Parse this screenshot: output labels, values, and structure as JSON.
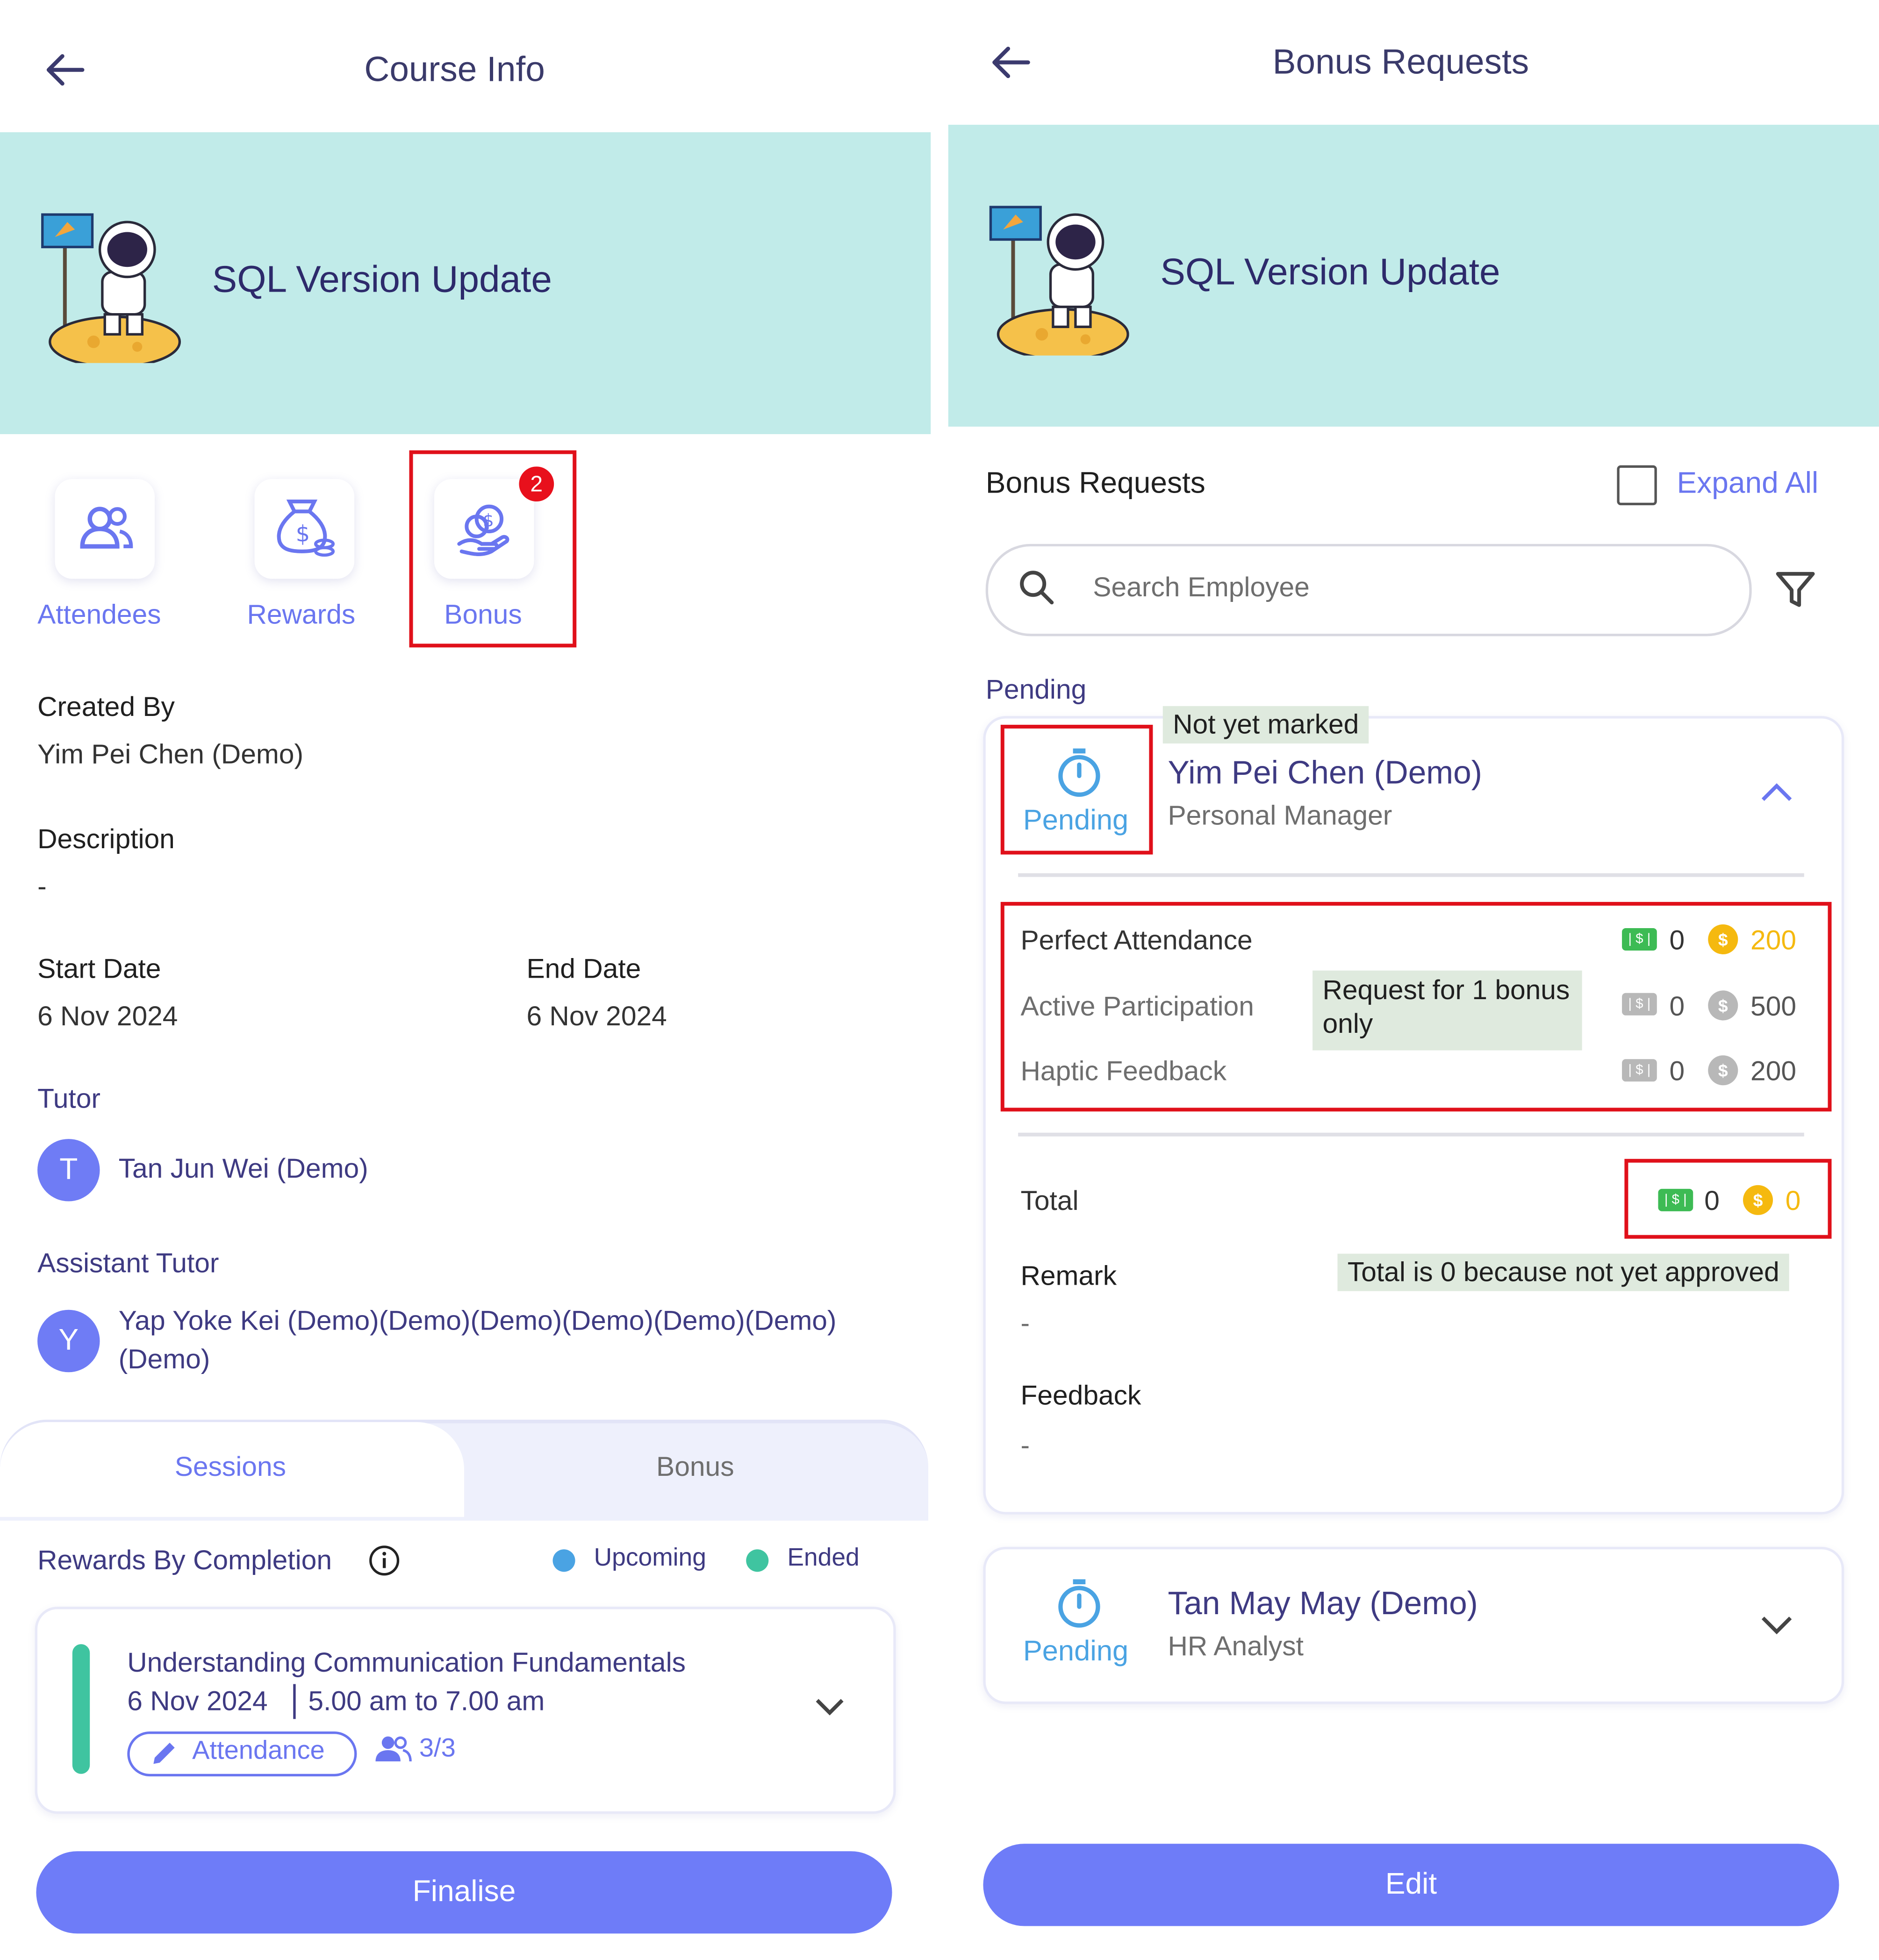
{
  "left": {
    "header": {
      "title": "Course Info"
    },
    "banner": {
      "course_title": "SQL Version Update"
    },
    "actions": [
      {
        "label": "Attendees",
        "icon": "people-icon"
      },
      {
        "label": "Rewards",
        "icon": "money-bag-icon"
      },
      {
        "label": "Bonus",
        "icon": "hand-coins-icon",
        "badge": "2"
      }
    ],
    "created_by": {
      "label": "Created By",
      "value": "Yim Pei Chen (Demo)"
    },
    "description": {
      "label": "Description",
      "value": "-"
    },
    "start_date": {
      "label": "Start Date",
      "value": "6 Nov 2024"
    },
    "end_date": {
      "label": "End Date",
      "value": "6 Nov 2024"
    },
    "tutor": {
      "label": "Tutor",
      "initial": "T",
      "name": "Tan Jun Wei (Demo)"
    },
    "assistant_tutor": {
      "label": "Assistant Tutor",
      "initial": "Y",
      "name_line1": "Yap Yoke Kei (Demo)(Demo)(Demo)(Demo)(Demo)(Demo)",
      "name_line2": "(Demo)"
    },
    "tabs": [
      {
        "label": "Sessions",
        "active": true
      },
      {
        "label": "Bonus",
        "active": false
      }
    ],
    "rewards_by_completion": {
      "label": "Rewards By Completion",
      "legend_upcoming": "Upcoming",
      "legend_ended": "Ended"
    },
    "session": {
      "title": "Understanding Communication Fundamentals",
      "date": "6 Nov 2024",
      "time": "5.00 am to 7.00 am",
      "attendance_label": "Attendance",
      "count": "3/3"
    },
    "finalise_button": "Finalise"
  },
  "right": {
    "header": {
      "title": "Bonus Requests"
    },
    "banner": {
      "course_title": "SQL Version Update"
    },
    "section_title": "Bonus Requests",
    "expand_all": "Expand All",
    "search": {
      "placeholder": "Search Employee"
    },
    "group_label": "Pending",
    "requests": [
      {
        "status": "Pending",
        "name": "Yim Pei Chen (Demo)",
        "role": "Personal Manager",
        "annotation": "Not yet marked",
        "items": [
          {
            "name": "Perfect Attendance",
            "cash": "0",
            "coins": "200",
            "active": true
          },
          {
            "name": "Active Participation",
            "cash": "0",
            "coins": "500",
            "active": false
          },
          {
            "name": "Haptic Feedback",
            "cash": "0",
            "coins": "200",
            "active": false
          }
        ],
        "items_annotation": "Request for 1 bonus only",
        "total": {
          "label": "Total",
          "cash": "0",
          "coins": "0"
        },
        "remark": {
          "label": "Remark",
          "value": "-",
          "annotation": "Total is 0 because not yet approved"
        },
        "feedback": {
          "label": "Feedback",
          "value": "-"
        }
      },
      {
        "status": "Pending",
        "name": "Tan May May (Demo)",
        "role": "HR Analyst"
      }
    ],
    "edit_button": "Edit"
  },
  "colors": {
    "accent": "#6e7cf8",
    "banner": "#c1ebe9",
    "highlight": "#e0101a",
    "coin_gold": "#f5b90f",
    "cash_green": "#3dbb54",
    "upcoming": "#4aa3e3",
    "ended": "#3fc4a0"
  }
}
